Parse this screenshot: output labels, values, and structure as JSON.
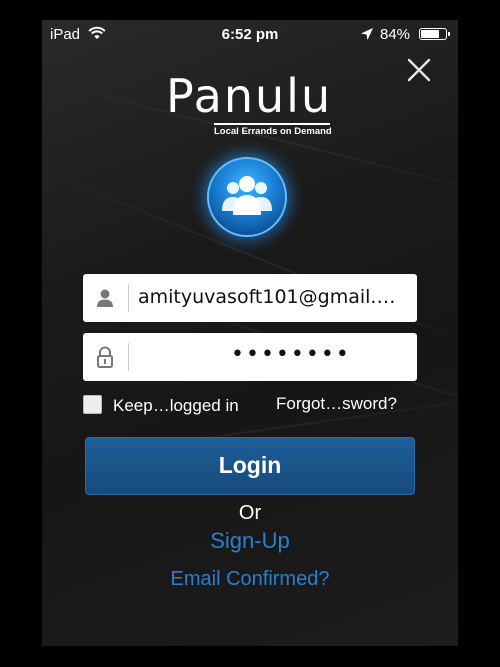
{
  "status_bar": {
    "device": "iPad",
    "time": "6:52 pm",
    "battery_percent": "84%",
    "battery_level": 0.84,
    "icons": [
      "wifi-icon",
      "location-icon",
      "battery-icon"
    ]
  },
  "close": {
    "icon": "close-icon"
  },
  "logo": {
    "name": "Panulu",
    "tagline": "Local Errands on Demand"
  },
  "hero_icon": "users-icon",
  "login_form": {
    "email": {
      "icon": "user-icon",
      "value": "amityuvasoft101@gmail.…"
    },
    "password": {
      "icon": "lock-icon",
      "value": "••••••••"
    },
    "keep_logged_in": {
      "label": "Keep…logged in",
      "checked": false
    },
    "forgot_password_label": "Forgot…sword?",
    "login_label": "Login"
  },
  "alternatives": {
    "or_label": "Or",
    "signup_label": "Sign-Up",
    "email_confirmed_label": "Email Confirmed?"
  },
  "colors": {
    "link": "#2a7fd0",
    "button": "#164a7b",
    "glow": "#1a7fd4"
  }
}
